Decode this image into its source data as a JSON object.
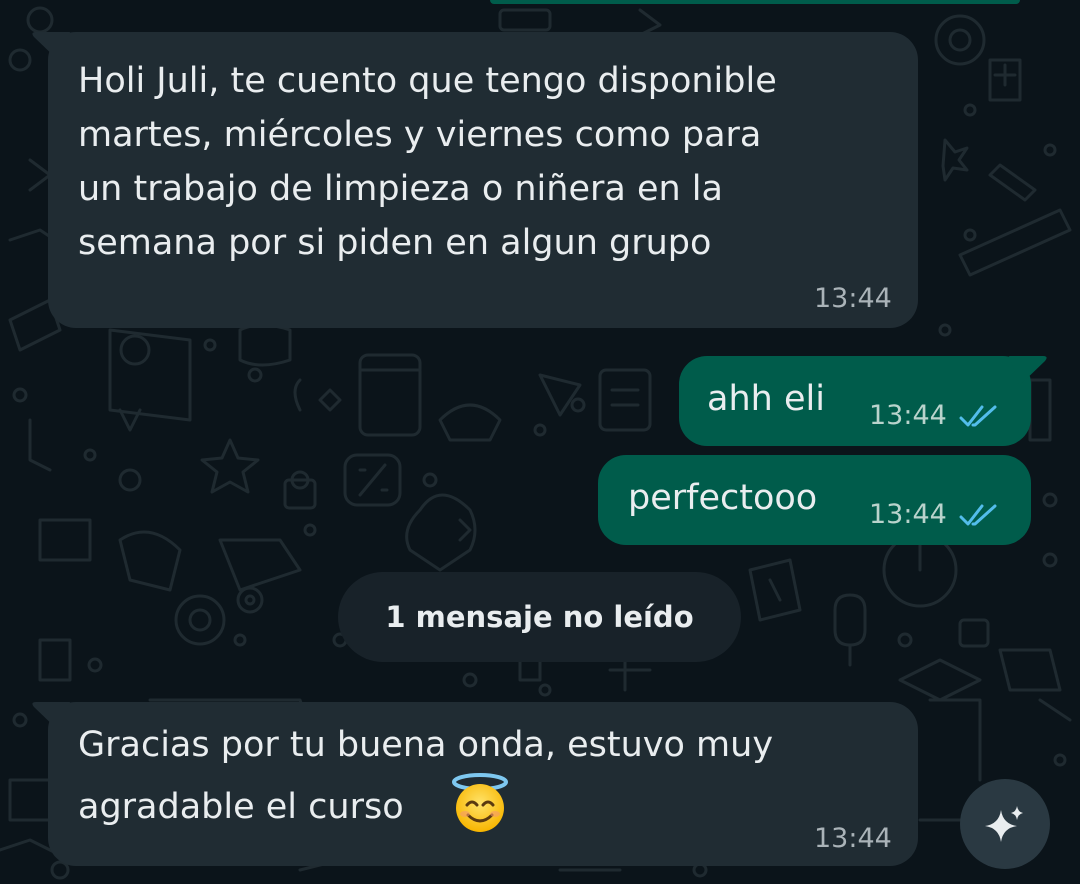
{
  "messages": [
    {
      "direction": "incoming",
      "text": "Holi Juli, te cuento que tengo disponible\nmartes, miércoles y viernes como para\nun trabajo de limpieza o niñera en la\nsemana por si piden en algun grupo",
      "time": "13:44"
    },
    {
      "direction": "outgoing",
      "text": "ahh eli",
      "time": "13:44",
      "status": "read"
    },
    {
      "direction": "outgoing",
      "text": "perfectooo",
      "time": "13:44",
      "status": "read"
    },
    {
      "direction": "incoming",
      "text_line1": "Gracias por tu buena onda, estuvo muy",
      "text_line2": "agradable el curso",
      "emoji": "smiling-face-with-halo",
      "time": "13:44"
    }
  ],
  "unread_divider": {
    "label": "1 mensaje no leído"
  },
  "fab": {
    "icon": "sparkle-icon"
  },
  "colors": {
    "background": "#0b141a",
    "incoming_bubble": "#202c33",
    "outgoing_bubble": "#005c4b",
    "read_ticks": "#53bdeb"
  }
}
